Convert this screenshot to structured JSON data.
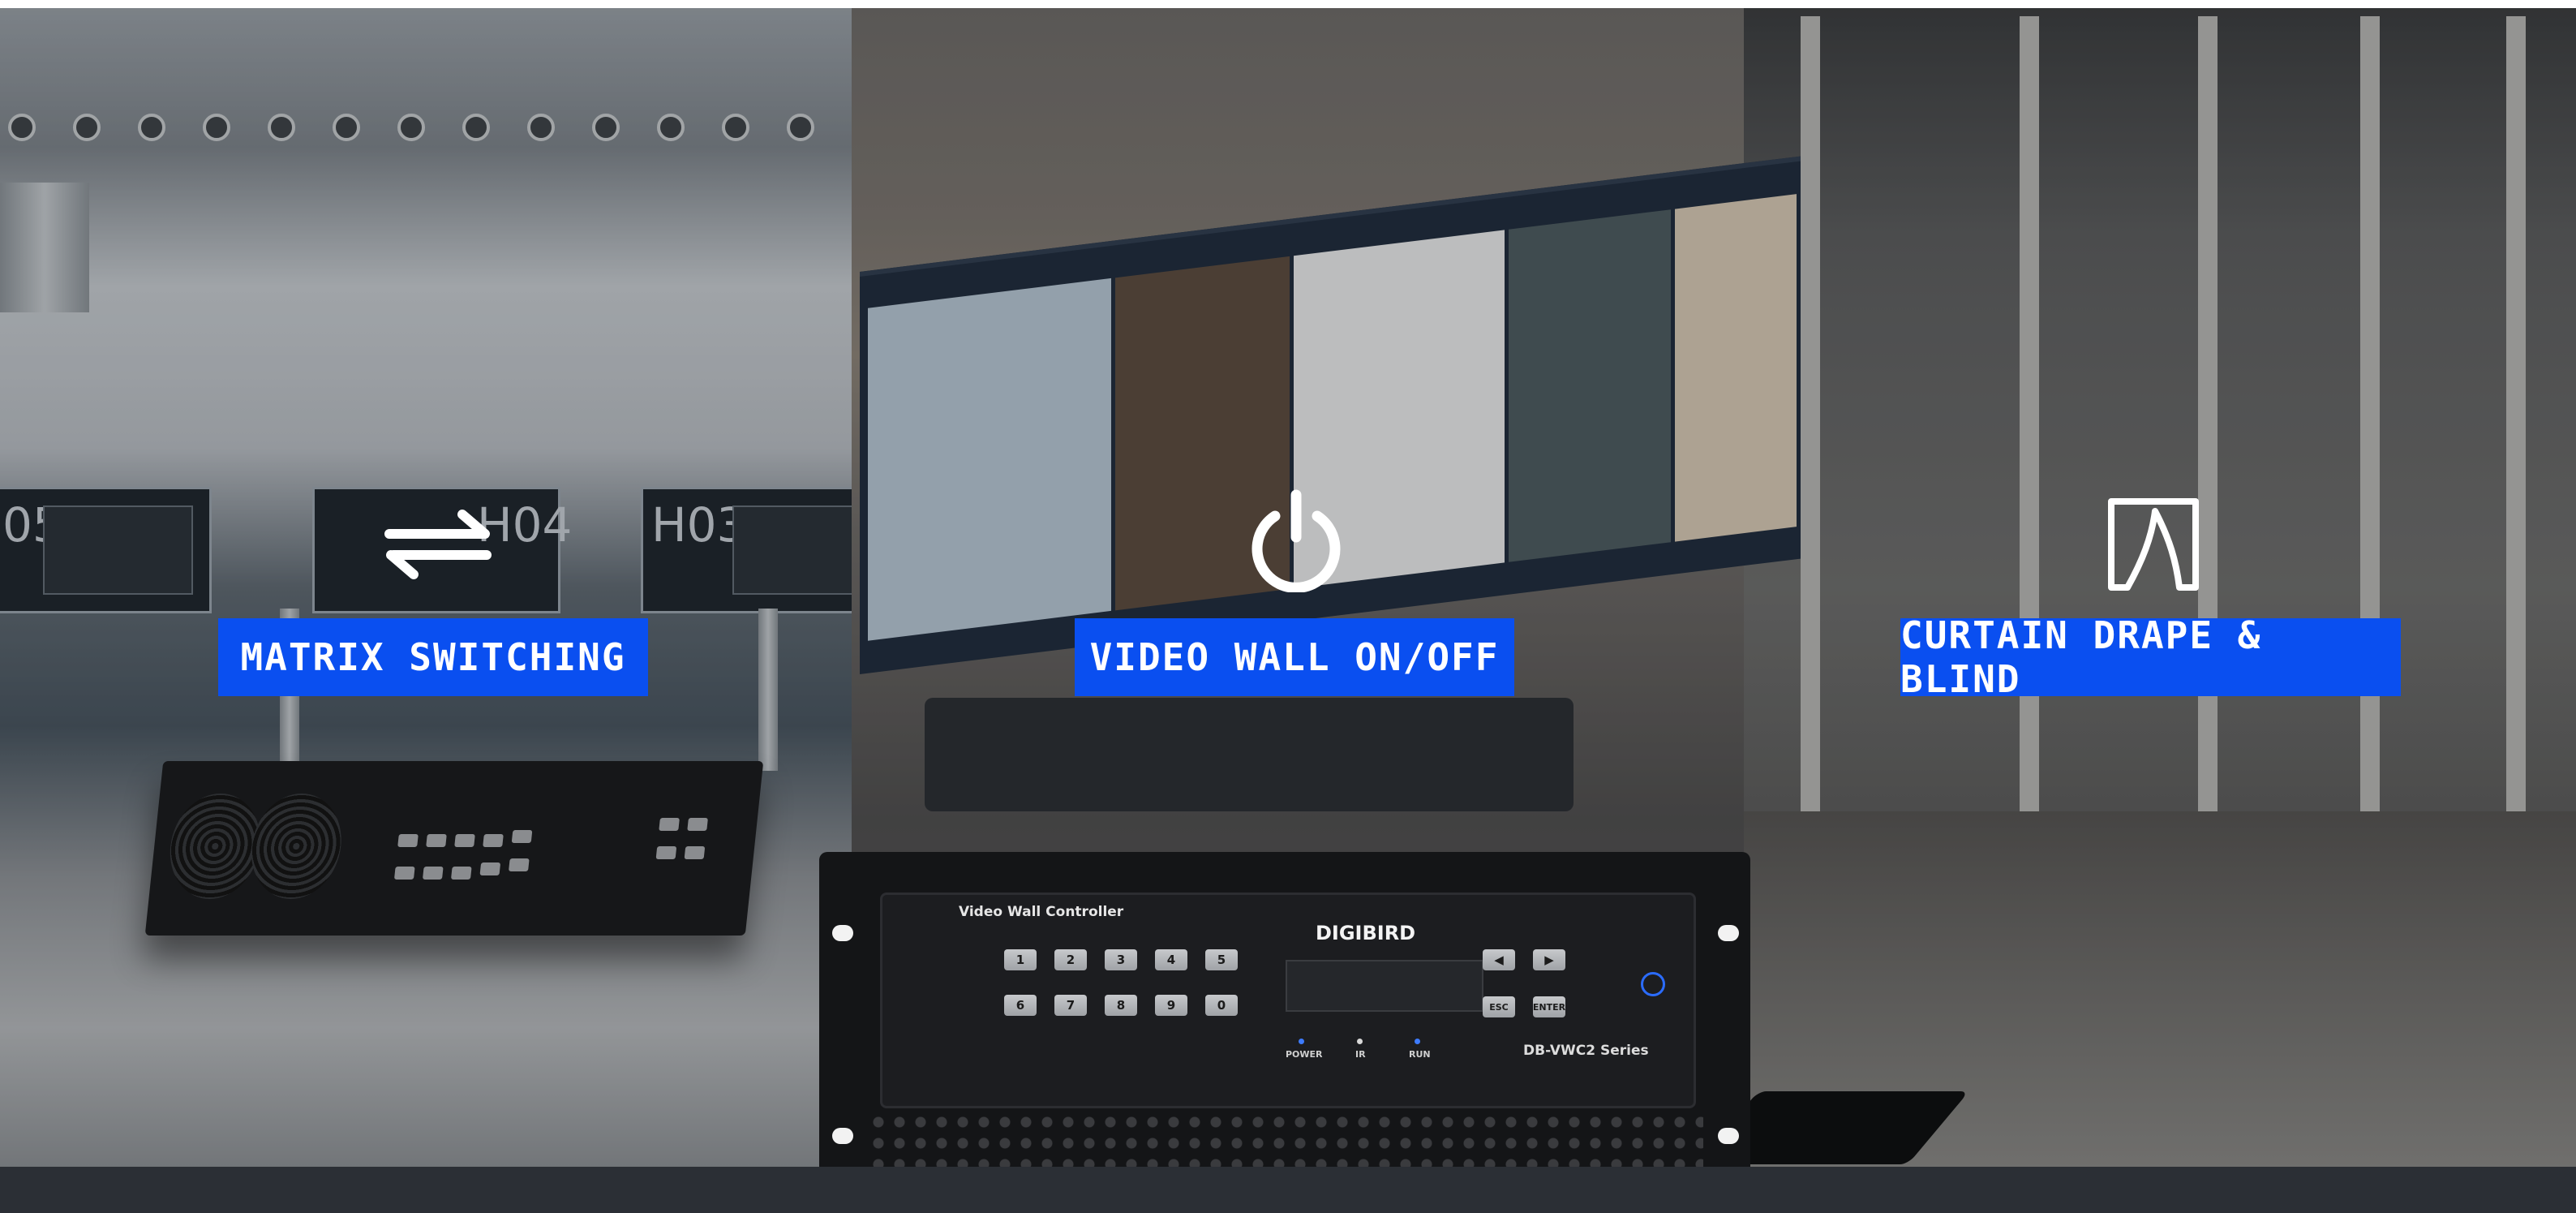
{
  "features": [
    {
      "label": "MATRIX SWITCHING",
      "icon": "switch-arrows-icon"
    },
    {
      "label": "VIDEO WALL ON/OFF",
      "icon": "power-icon"
    },
    {
      "label": "CURTAIN DRAPE & BLIND",
      "icon": "curtain-icon"
    }
  ],
  "airport_signs": [
    "05",
    "H04",
    "H03"
  ],
  "controller": {
    "title": "Video Wall Controller",
    "brand": "DIGIBIRD",
    "series": "DB-VWC2 Series",
    "number_keys_row1": [
      "1",
      "2",
      "3",
      "4",
      "5"
    ],
    "number_keys_row2": [
      "6",
      "7",
      "8",
      "9",
      "0"
    ],
    "nav_keys": [
      "◀",
      "▶"
    ],
    "function_keys": [
      "ESC",
      "ENTER"
    ],
    "indicators": [
      "POWER",
      "IR",
      "RUN"
    ]
  },
  "colors": {
    "label_background": "#0a4ff0",
    "label_text": "#ffffff",
    "bottom_bar": "#2b2f35"
  }
}
